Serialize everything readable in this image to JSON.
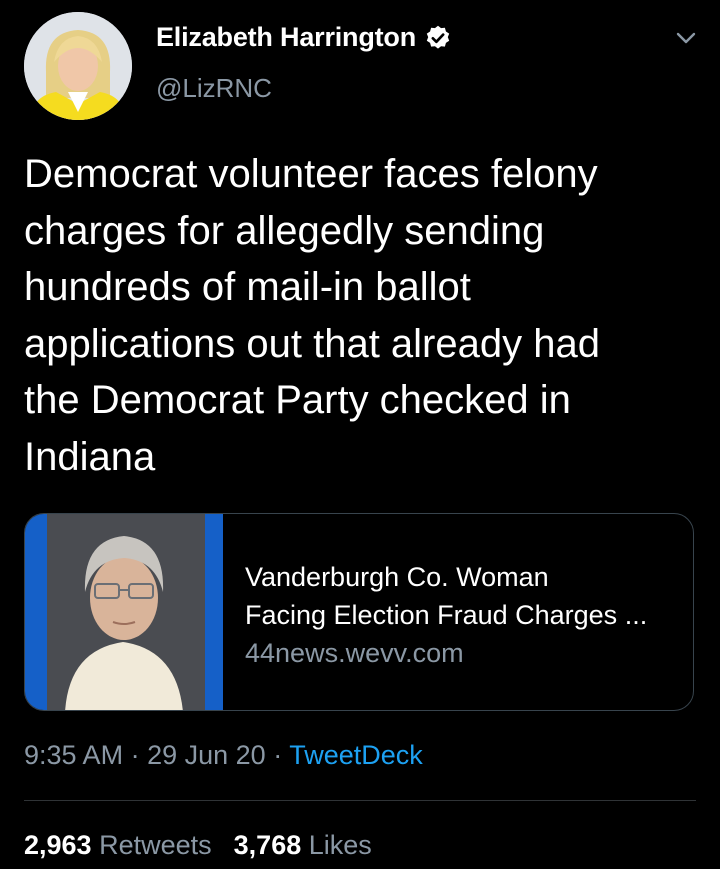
{
  "author": {
    "name": "Elizabeth Harrington",
    "handle": "@LizRNC",
    "verified": true
  },
  "tweet": {
    "text": "Democrat volunteer faces felony\ncharges for allegedly sending\nhundreds of mail-in ballot\napplications out that already had\nthe Democrat Party checked in\nIndiana"
  },
  "link_card": {
    "title": "Vanderburgh Co. Woman\nFacing Election Fraud Charges ...",
    "domain": "44news.wevv.com"
  },
  "meta": {
    "time": "9:35 AM",
    "separator": "·",
    "date": "29 Jun 20",
    "source": "TweetDeck"
  },
  "stats": {
    "retweets_count": "2,963",
    "retweets_label": "Retweets",
    "likes_count": "3,768",
    "likes_label": "Likes"
  },
  "colors": {
    "background": "#000000",
    "secondary_text": "#8b98a5",
    "link": "#1da1f2",
    "verified_badge": "#ffffff"
  },
  "icons": [
    "verified-badge-icon",
    "chevron-down-icon"
  ]
}
